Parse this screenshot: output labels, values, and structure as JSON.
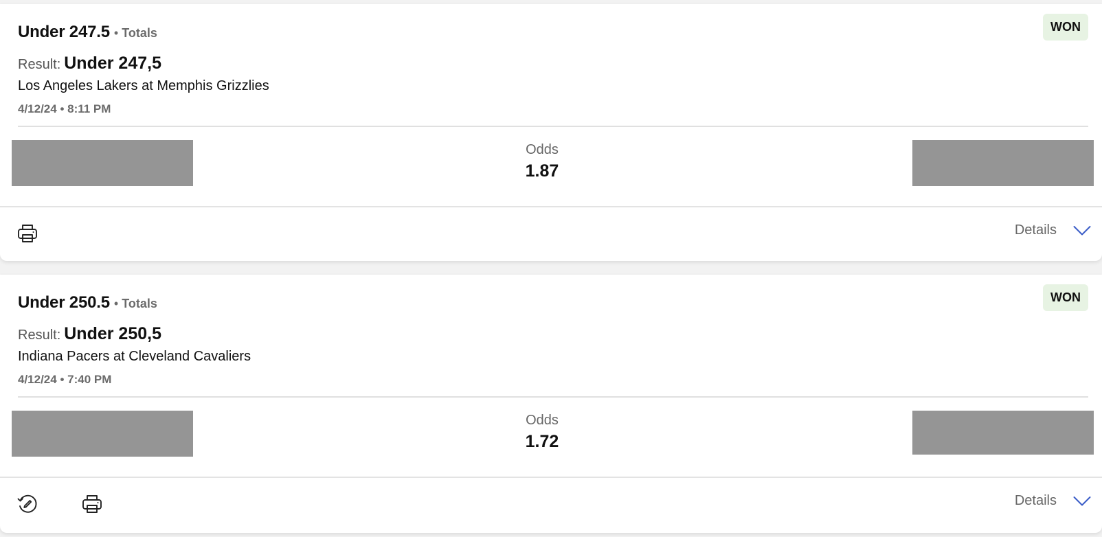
{
  "colors": {
    "won_badge_bg": "#e7f3e3",
    "redacted_block": "#959595",
    "chevron_blue": "#3a5cc7",
    "muted_text": "#6b6b6b"
  },
  "bets": [
    {
      "title": "Under 247.5",
      "market": "Totals",
      "status": "WON",
      "result_label": "Result:",
      "result_value": "Under 247,5",
      "event": "Los Angeles Lakers at Memphis Grizzlies",
      "datetime": "4/12/24 • 8:11 PM",
      "odds_label": "Odds",
      "odds_value": "1.87",
      "details_label": "Details",
      "icons": [
        "printer-icon",
        "chevron-down-icon"
      ]
    },
    {
      "title": "Under 250.5",
      "market": "Totals",
      "status": "WON",
      "result_label": "Result:",
      "result_value": "Under 250,5",
      "event": "Indiana Pacers at Cleveland Cavaliers",
      "datetime": "4/12/24 • 7:40 PM",
      "odds_label": "Odds",
      "odds_value": "1.72",
      "details_label": "Details",
      "icons": [
        "reuse-bet-icon",
        "printer-icon",
        "chevron-down-icon"
      ]
    }
  ]
}
